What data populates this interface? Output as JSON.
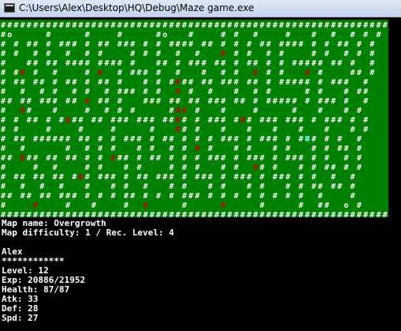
{
  "window": {
    "title": "C:\\Users\\Alex\\Desktop\\HQ\\Debug\\Maze game.exe"
  },
  "colors": {
    "maze_bg": "#008000",
    "wall": "#ffffff",
    "enemy": "#cc0000",
    "goal": "#00ffff",
    "console_bg": "#000000",
    "console_text": "#ffffff"
  },
  "maze": {
    "symbols": {
      "wall": "#",
      "exit": "o",
      "enemy": "#",
      "player": "%"
    },
    "rows": [
      "############################################################",
      "#o     #     #    #     #o   #    # #  #    #   #  #  # # #",
      "# # ## # ### # ## ### # # #### ## # # # ## #### # # ## # #",
      "# #  # #  #  # #    # # #  #  #   # # #  # #    # #  # # #",
      "#   ## ## #### #### #   ## # ### ## # ## # # ##### ## #  #",
      "# #  #  #    #    # ### #  #   #  # #    # #     #    ## #",
      "# ## ## # ## # ## #   # # #### ## ### ## # ##### # ###  #",
      "#  #  # #  # #  # ### # #    #  #   #  # #     # #   # ##",
      "## ## ### ## # ## #   ### ## ## ### ## # ##### # ### #  #",
      "#   #   #    #  # # #     #   #   #    #     #   #   # #",
      "# # ## # #### ## ### ### ## # # ### ### ### ### # ### # #",
      "# #    #    #    #     #    # #   #   #   #   #   #   # #",
      "# ## ###### ## # # ### # ## # # # ### # ### # ### # #  #",
      "#  #      #  # # #   # #  # # # #   # #   # #   # # ## #",
      "## ### ## ## # # ### # ## # # # ### # ### # ### # #  # #",
      "#    #  #    # #   # #    # # #   # #   # #   # # ## # #",
      "# ## ## ## ### ### # ## ### # ### # ### # ### # #  #  #",
      "#  #  #  #   #   # #  #   # #   # #   # #   # # ## ## #",
      "## ## ## ### # # # ## # # # ### # # # # # # # #  #    #",
      "#    #    #   #    #  #     #     #     #     #  ##  o #",
      "############################################################"
    ],
    "enemies": [
      {
        "row": 3,
        "col": 34
      },
      {
        "row": 5,
        "col": 3
      },
      {
        "row": 5,
        "col": 15
      },
      {
        "row": 5,
        "col": 39
      },
      {
        "row": 5,
        "col": 47
      },
      {
        "row": 6,
        "col": 27
      },
      {
        "row": 7,
        "col": 27
      },
      {
        "row": 8,
        "col": 13
      },
      {
        "row": 9,
        "col": 3
      },
      {
        "row": 9,
        "col": 27
      },
      {
        "row": 9,
        "col": 28
      },
      {
        "row": 10,
        "col": 10
      },
      {
        "row": 10,
        "col": 27
      },
      {
        "row": 10,
        "col": 37
      },
      {
        "row": 11,
        "col": 27
      },
      {
        "row": 13,
        "col": 30
      },
      {
        "row": 14,
        "col": 3
      },
      {
        "row": 14,
        "col": 17
      },
      {
        "row": 15,
        "col": 39
      },
      {
        "row": 16,
        "col": 12
      },
      {
        "row": 19,
        "col": 5
      },
      {
        "row": 19,
        "col": 22
      },
      {
        "row": 19,
        "col": 34
      }
    ],
    "player": {
      "row": 12,
      "col": 47
    }
  },
  "info": {
    "map_name_line": "Map name: Overgrowth",
    "map_difficulty_line": "Map difficulty: 1 / Rec. Level: 4",
    "blank_line": "",
    "player_name": "Alex",
    "separator": "************",
    "level_line": "Level: 12",
    "exp_line": "Exp: 20886/21952",
    "health_line": "Health: 87/87",
    "atk_line": "Atk: 33",
    "def_line": "Def: 28",
    "spd_line": "Spd: 27"
  }
}
